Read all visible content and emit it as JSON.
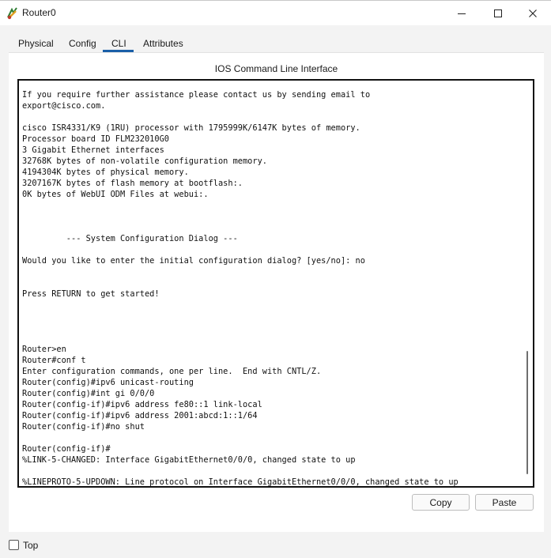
{
  "window": {
    "title": "Router0",
    "icon": "router-app-icon"
  },
  "tabs": [
    {
      "label": "Physical"
    },
    {
      "label": "Config"
    },
    {
      "label": "CLI",
      "active": true
    },
    {
      "label": "Attributes"
    }
  ],
  "cli": {
    "heading": "IOS Command Line Interface",
    "lines": [
      "If you require further assistance please contact us by sending email to",
      "export@cisco.com.",
      "",
      "cisco ISR4331/K9 (1RU) processor with 1795999K/6147K bytes of memory.",
      "Processor board ID FLM232010G0",
      "3 Gigabit Ethernet interfaces",
      "32768K bytes of non-volatile configuration memory.",
      "4194304K bytes of physical memory.",
      "3207167K bytes of flash memory at bootflash:.",
      "0K bytes of WebUI ODM Files at webui:.",
      "",
      "",
      "",
      "         --- System Configuration Dialog ---",
      "",
      "Would you like to enter the initial configuration dialog? [yes/no]: no",
      "",
      "",
      "Press RETURN to get started!",
      "",
      "",
      "",
      "",
      "Router>en",
      "Router#conf t",
      "Enter configuration commands, one per line.  End with CNTL/Z.",
      "Router(config)#ipv6 unicast-routing",
      "Router(config)#int gi 0/0/0",
      "Router(config-if)#ipv6 address fe80::1 link-local",
      "Router(config-if)#ipv6 address 2001:abcd:1::1/64",
      "Router(config-if)#no shut",
      "",
      "Router(config-if)#",
      "%LINK-5-CHANGED: Interface GigabitEthernet0/0/0, changed state to up",
      "",
      "%LINEPROTO-5-UPDOWN: Line protocol on Interface GigabitEthernet0/0/0, changed state to up"
    ]
  },
  "buttons": {
    "copy": "Copy",
    "paste": "Paste"
  },
  "footer": {
    "top_label": "Top",
    "top_checked": false
  }
}
